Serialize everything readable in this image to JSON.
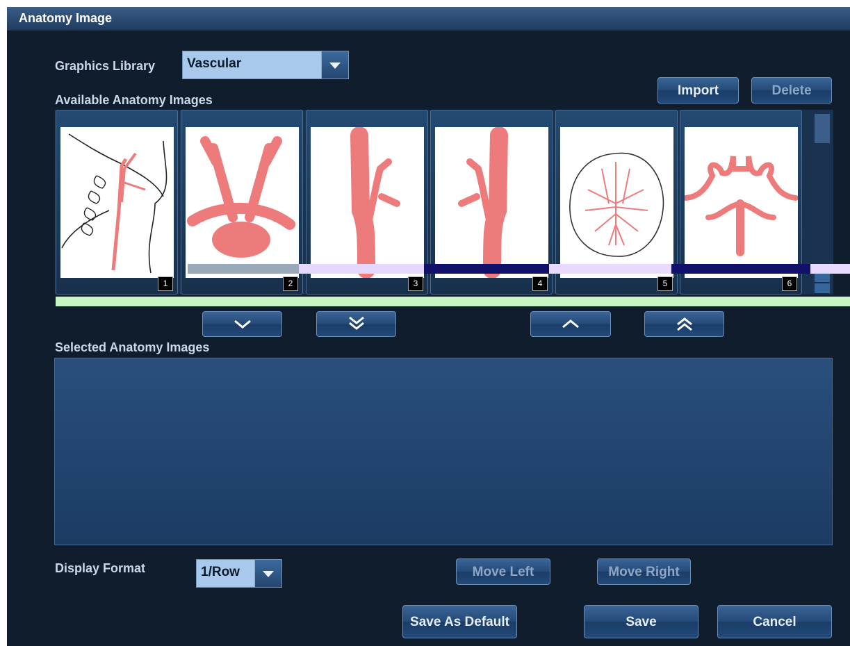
{
  "window": {
    "title": "Anatomy Image"
  },
  "graphics_library": {
    "label": "Graphics Library",
    "selected": "Vascular"
  },
  "toolbar": {
    "import_label": "Import",
    "delete_label": "Delete"
  },
  "available": {
    "label": "Available Anatomy Images",
    "thumbnails": [
      {
        "number": "1",
        "depicts": "neck-vessels"
      },
      {
        "number": "2",
        "depicts": "aortic-arch"
      },
      {
        "number": "3",
        "depicts": "carotid-bifurcation-right"
      },
      {
        "number": "4",
        "depicts": "carotid-bifurcation-left"
      },
      {
        "number": "5",
        "depicts": "brain-vessels"
      },
      {
        "number": "6",
        "depicts": "circle-of-willis"
      }
    ]
  },
  "move_buttons": {
    "down": "chevron-down-icon",
    "down_all": "double-chevron-down-icon",
    "up": "chevron-up-icon",
    "up_all": "double-chevron-up-icon"
  },
  "selected": {
    "label": "Selected Anatomy Images"
  },
  "display_format": {
    "label": "Display Format",
    "selected": "1/Row"
  },
  "buttons": {
    "move_left": "Move Left",
    "move_right": "Move Right",
    "save_default": "Save As Default",
    "save": "Save",
    "cancel": "Cancel"
  },
  "colors": {
    "vessel": "#ee7b7b",
    "background": "#0f1d2d",
    "panel": "#244a77"
  }
}
